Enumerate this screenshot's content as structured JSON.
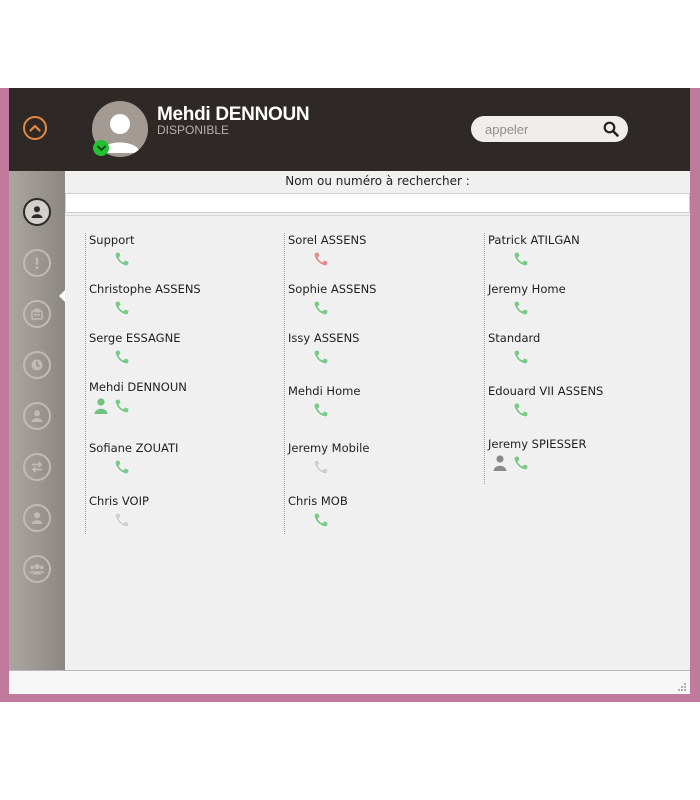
{
  "user": {
    "name": "Mehdi DENNOUN",
    "status": "DISPONIBLE",
    "presence_color": "#22c233"
  },
  "call": {
    "placeholder": "appeler",
    "search_icon": "search-icon"
  },
  "accent_color": "#e58a3c",
  "sidebar": {
    "items": [
      {
        "icon": "contacts-icon",
        "active": true
      },
      {
        "icon": "alert-icon"
      },
      {
        "icon": "voicemail-icon"
      },
      {
        "icon": "history-icon"
      },
      {
        "icon": "user-icon"
      },
      {
        "icon": "transfer-icon"
      },
      {
        "icon": "profile-icon"
      },
      {
        "icon": "group-icon"
      }
    ]
  },
  "search": {
    "label": "Nom ou numéro à rechercher :",
    "value": ""
  },
  "contacts": {
    "columns": [
      [
        {
          "name": "Support",
          "phone": "green"
        },
        {
          "name": "Christophe ASSENS",
          "phone": "green"
        },
        {
          "name": "Serge ESSAGNE",
          "phone": "green"
        },
        {
          "name": "Mehdi DENNOUN",
          "phone": "green",
          "person": "green"
        },
        {
          "name": "Sofiane ZOUATI",
          "phone": "green"
        },
        {
          "name": "Chris VOIP",
          "phone": "gray"
        }
      ],
      [
        {
          "name": "Sorel ASSENS",
          "phone": "red"
        },
        {
          "name": "Sophie ASSENS",
          "phone": "green"
        },
        {
          "name": "Issy ASSENS",
          "phone": "green"
        },
        {
          "name": "Mehdi Home",
          "phone": "green"
        },
        {
          "name": "Jeremy Mobile",
          "phone": "gray"
        },
        {
          "name": "Chris MOB",
          "phone": "green"
        }
      ],
      [
        {
          "name": "Patrick ATILGAN",
          "phone": "green"
        },
        {
          "name": "Jeremy Home",
          "phone": "green"
        },
        {
          "name": "Standard",
          "phone": "green"
        },
        {
          "name": "Edouard VII ASSENS",
          "phone": "green"
        },
        {
          "name": "Jeremy SPIESSER",
          "phone": "green",
          "person": "gray"
        }
      ]
    ]
  },
  "colors": {
    "phone_green": "#7cc98a",
    "phone_red": "#e08f8f",
    "phone_gray": "#cfcfcf",
    "person_green": "#6ec27e",
    "person_gray": "#8a8a8a"
  }
}
